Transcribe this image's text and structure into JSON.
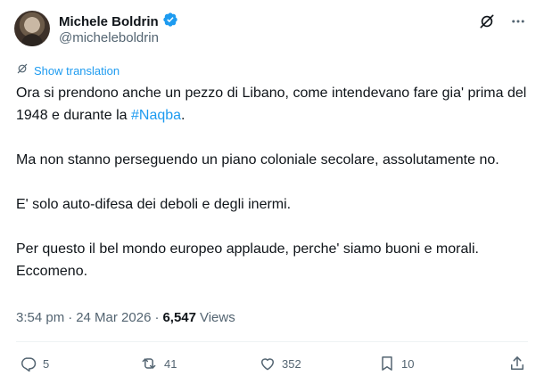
{
  "author": {
    "name": "Michele Boldrin",
    "handle": "@micheleboldrin"
  },
  "translation": {
    "label": "Show translation"
  },
  "tweet": {
    "line1_part1": "Ora si prendono anche un pezzo di Libano, come intendevano fare gia' prima del 1948 e durante la ",
    "hashtag": "#Naqba",
    "line1_part2": ".",
    "para2": "Ma non stanno perseguendo un piano coloniale secolare, assolutamente no.",
    "para3": "E' solo auto-difesa dei deboli e degli inermi.",
    "para4": "Per questo il bel mondo europeo applaude, perche' siamo buoni e morali. Eccomeno."
  },
  "meta": {
    "time": "3:54 pm",
    "separator1": "·",
    "date": "24 Mar 2026",
    "separator2": "·",
    "views_count": "6,547",
    "views_label": "Views"
  },
  "actions": {
    "replies": "5",
    "reposts": "41",
    "likes": "352",
    "bookmarks": "10"
  },
  "icons": {
    "verified": "verified-badge-icon",
    "grok": "grok-icon",
    "more": "more-icon",
    "translate": "translate-icon",
    "reply": "reply-icon",
    "repost": "repost-icon",
    "like": "heart-icon",
    "bookmark": "bookmark-icon",
    "share": "share-icon"
  },
  "colors": {
    "accent": "#1d9bf0",
    "text": "#0f1419",
    "muted": "#536471"
  }
}
